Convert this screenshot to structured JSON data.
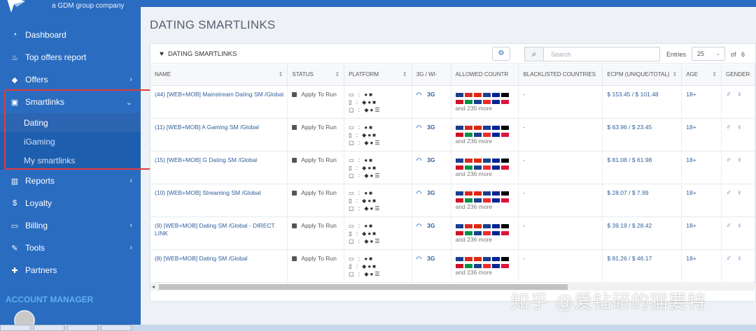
{
  "brand": {
    "tagline": "a GDM group company"
  },
  "sidebar": {
    "items": [
      {
        "label": "Dashboard",
        "icon": "dashboard-icon"
      },
      {
        "label": "Top offers report",
        "icon": "fire-icon"
      },
      {
        "label": "Offers",
        "icon": "tag-icon"
      },
      {
        "label": "Smartlinks",
        "icon": "camera-icon"
      },
      {
        "label": "Reports",
        "icon": "bar-chart-icon"
      },
      {
        "label": "Loyalty",
        "icon": "dollar-icon"
      },
      {
        "label": "Billing",
        "icon": "credit-card-icon"
      },
      {
        "label": "Tools",
        "icon": "wrench-icon"
      },
      {
        "label": "Partners",
        "icon": "gift-icon"
      }
    ],
    "smartlinks_sub": [
      "Dating",
      "iGaming",
      "My smartlinks"
    ],
    "account_manager": "ACCOUNT MANAGER"
  },
  "page": {
    "title": "DATING SMARTLINKS"
  },
  "panel": {
    "title": "DATING SMARTLINKS",
    "search_placeholder": "Search",
    "entries_label": "Entries",
    "entries_value": "25",
    "of_label": "of",
    "pages_total": "6"
  },
  "table": {
    "headers": [
      "NAME",
      "STATUS",
      "PLATFORM",
      "3G / WI-",
      "ALLOWED COUNTR",
      "BLACKLISTED COUNTRIES",
      "ECPM (UNIQUE/TOTAL)",
      "AGE",
      "GENDER"
    ],
    "rows": [
      {
        "name": "(44) [WEB+MOB] Mainstream Dating SM /Global",
        "status": "Apply To Run",
        "net": "3G",
        "more": "and 235 more",
        "blacklist": "-",
        "ecpm": "$ 153.45 / $ 101.48",
        "age": "18+"
      },
      {
        "name": "(11) [WEB+MOB] A Gaming SM /Global",
        "status": "Apply To Run",
        "net": "3G",
        "more": "and 236 more",
        "blacklist": "-",
        "ecpm": "$ 63.96 / $ 23.45",
        "age": "18+"
      },
      {
        "name": "(15) [WEB+MOB] G Dating SM /Global",
        "status": "Apply To Run",
        "net": "3G",
        "more": "and 236 more",
        "blacklist": "-",
        "ecpm": "$ 81.08 / $ 61.98",
        "age": "18+"
      },
      {
        "name": "(10) [WEB+MOB] Streaming SM /Global",
        "status": "Apply To Run",
        "net": "3G",
        "more": "and 236 more",
        "blacklist": "-",
        "ecpm": "$ 28.07 / $ 7.99",
        "age": "18+"
      },
      {
        "name": "(9) [WEB+MOB] Dating SM /Global - DIRECT LINK",
        "status": "Apply To Run",
        "net": "3G",
        "more": "and 236 more",
        "blacklist": "-",
        "ecpm": "$ 39.19 / $ 28.42",
        "age": "18+"
      },
      {
        "name": "(8) [WEB+MOB] Dating SM /Global",
        "status": "Apply To Run",
        "net": "3G",
        "more": "and 236 more",
        "blacklist": "-",
        "ecpm": "$ 81.26 / $ 46.17",
        "age": "18+"
      }
    ]
  },
  "watermark": "知乎 @爱钻研的猫要特",
  "colors": {
    "sidebar": "#2a6cc0",
    "annotation": "#e43b3b",
    "link": "#2f5f9b"
  }
}
